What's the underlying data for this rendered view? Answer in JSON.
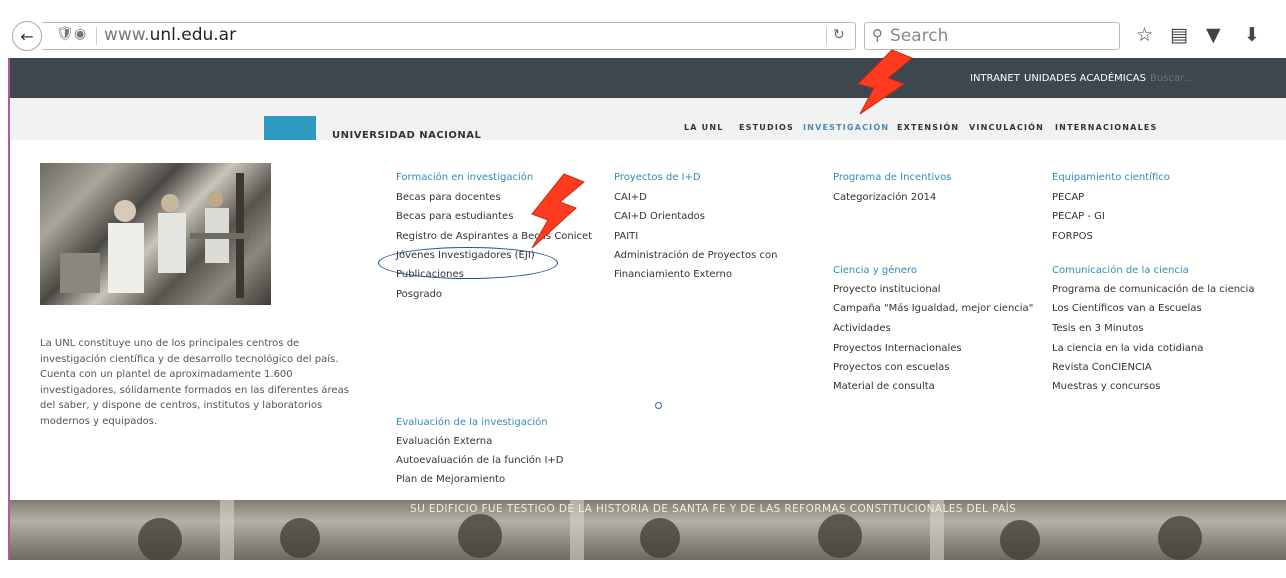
{
  "browser": {
    "url_prefix": "www.",
    "url_host": "unl.edu.ar",
    "search_placeholder": "Search",
    "icons": [
      "back-arrow-icon",
      "shield-icon",
      "globe-icon",
      "reload-icon",
      "search-icon",
      "star-icon",
      "reading-list-icon",
      "pocket-icon",
      "download-icon"
    ]
  },
  "topbar": {
    "links": [
      "INTRANET",
      "UNIDADES ACADÉMICAS"
    ],
    "search_placeholder": "Buscar..."
  },
  "header": {
    "logo_text": "UNIVERSIDAD NACIONAL",
    "menu": [
      {
        "label": "LA UNL",
        "active": false
      },
      {
        "label": "ESTUDIOS",
        "active": false
      },
      {
        "label": "INVESTIGACIÓN",
        "active": true
      },
      {
        "label": "EXTENSIÓN",
        "active": false
      },
      {
        "label": "VINCULACIÓN",
        "active": false
      },
      {
        "label": "INTERNACIONALES",
        "active": false
      }
    ]
  },
  "mega": {
    "intro": "La UNL constituye uno de los principales centros de investigación científica y de desarrollo tecnológico del país. Cuenta con un plantel de aproximadamente 1.600 investigadores, sólidamente formados en las diferentes áreas del saber, y dispone de centros, institutos y laboratorios modernos y equipados.",
    "formacion": {
      "title": "Formación en investigación",
      "items": [
        "Becas para docentes",
        "Becas para estudiantes",
        "Registro de Aspirantes a Becas Conicet",
        "Jóvenes Investigadores (EJI)",
        "Publicaciones",
        "Posgrado"
      ]
    },
    "evaluacion": {
      "title": "Evaluación de la investigación",
      "items": [
        "Evaluación Externa",
        "Autoevaluación de la función I+D",
        "Plan de Mejoramiento"
      ]
    },
    "proyectos": {
      "title": "Proyectos de I+D",
      "items": [
        "CAI+D",
        "CAI+D Orientados",
        "PAITI",
        "Administración de Proyectos con",
        "Financiamiento Externo"
      ]
    },
    "incentivos": {
      "title": "Programa de Incentivos",
      "items": [
        "Categorización 2014"
      ]
    },
    "ciencia_genero": {
      "title": "Ciencia y género",
      "items": [
        "Proyecto institucional",
        "Campaña \"Más Igualdad, mejor ciencia\"",
        "Actividades",
        "Proyectos Internacionales",
        "Proyectos con escuelas",
        "Material de consulta"
      ]
    },
    "equipamiento": {
      "title": "Equipamiento científico",
      "items": [
        "PECAP",
        "PECAP - GI",
        "FORPOS"
      ]
    },
    "comunicacion": {
      "title": "Comunicación de la ciencia",
      "items": [
        "Programa de comunicación de la ciencia",
        "Los Científicos van a Escuelas",
        "Tesis en 3 Minutos",
        "La ciencia en la vida cotidiana",
        "Revista ConCIENCIA",
        "Muestras y concursos"
      ]
    }
  },
  "banner": {
    "text": "SU EDIFICIO FUE TESTIGO DE LA HISTORIA DE SANTA FE Y DE LAS REFORMAS CONSTITUCIONALES DEL PAÍS"
  },
  "colors": {
    "topbar_bg": "#3d4750",
    "accent": "#2f8db8",
    "annotation_arrow": "#ff3b1f",
    "annotation_ellipse": "#1f4f8c"
  }
}
